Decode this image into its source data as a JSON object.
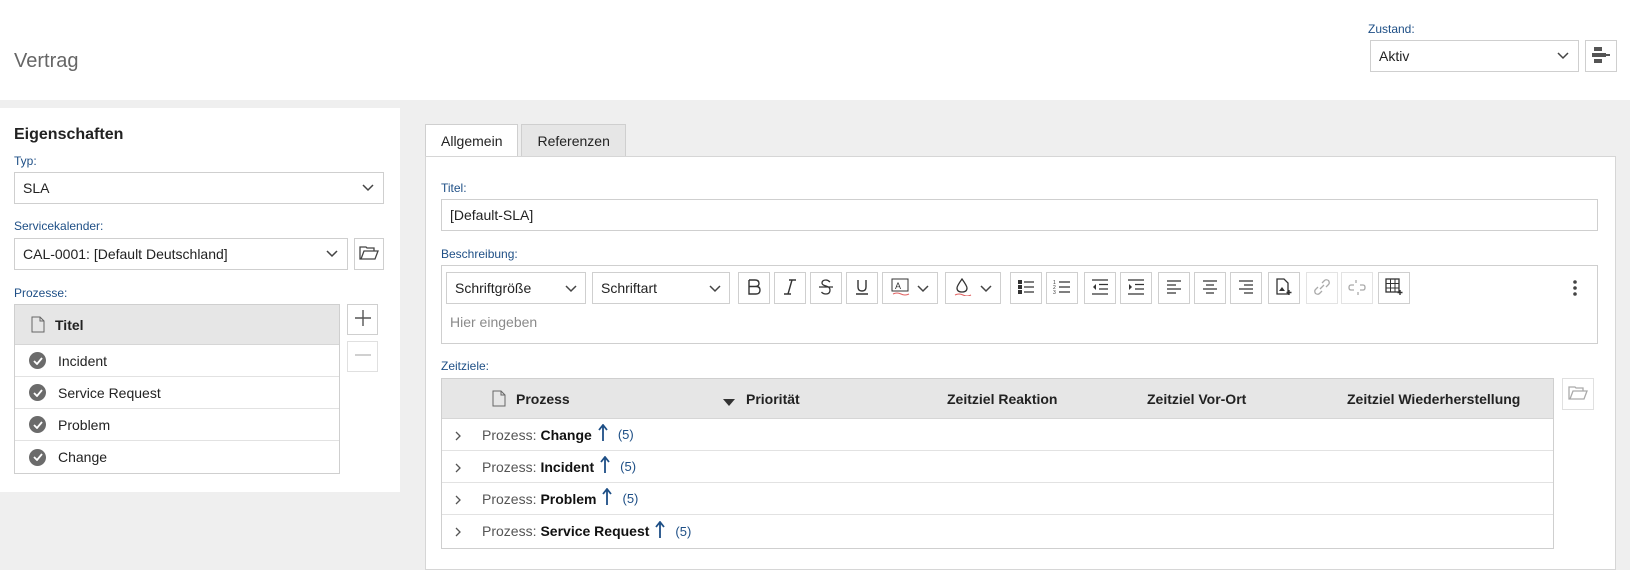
{
  "header": {
    "title": "Vertrag",
    "status_label": "Zustand:",
    "status_value": "Aktiv"
  },
  "properties": {
    "title": "Eigenschaften",
    "type_label": "Typ:",
    "type_value": "SLA",
    "calendar_label": "Servicekalender:",
    "calendar_value": "CAL-0001: [Default Deutschland]",
    "processes_label": "Prozesse:",
    "processes_column": "Titel",
    "processes": [
      "Incident",
      "Service Request",
      "Problem",
      "Change"
    ]
  },
  "tabs": [
    "Allgemein",
    "Referenzen"
  ],
  "general": {
    "title_label": "Titel:",
    "title_value": "[Default-SLA]",
    "description_label": "Beschreibung:",
    "font_size_select": "Schriftgröße",
    "font_family_select": "Schriftart",
    "editor_placeholder": "Hier eingeben",
    "targets_label": "Zeitziele:",
    "targets_columns": {
      "process": "Prozess",
      "priority": "Priorität",
      "reaction": "Zeitziel Reaktion",
      "onsite": "Zeitziel Vor-Ort",
      "restore": "Zeitziel Wiederherstellung"
    },
    "group_prefix": "Prozess:",
    "groups": [
      {
        "name": "Change",
        "count": "(5)"
      },
      {
        "name": "Incident",
        "count": "(5)"
      },
      {
        "name": "Problem",
        "count": "(5)"
      },
      {
        "name": "Service Request",
        "count": "(5)"
      }
    ]
  },
  "colors": {
    "label_blue": "#1e4f86",
    "header_gray": "#e6e6e6",
    "background": "#efefef"
  }
}
